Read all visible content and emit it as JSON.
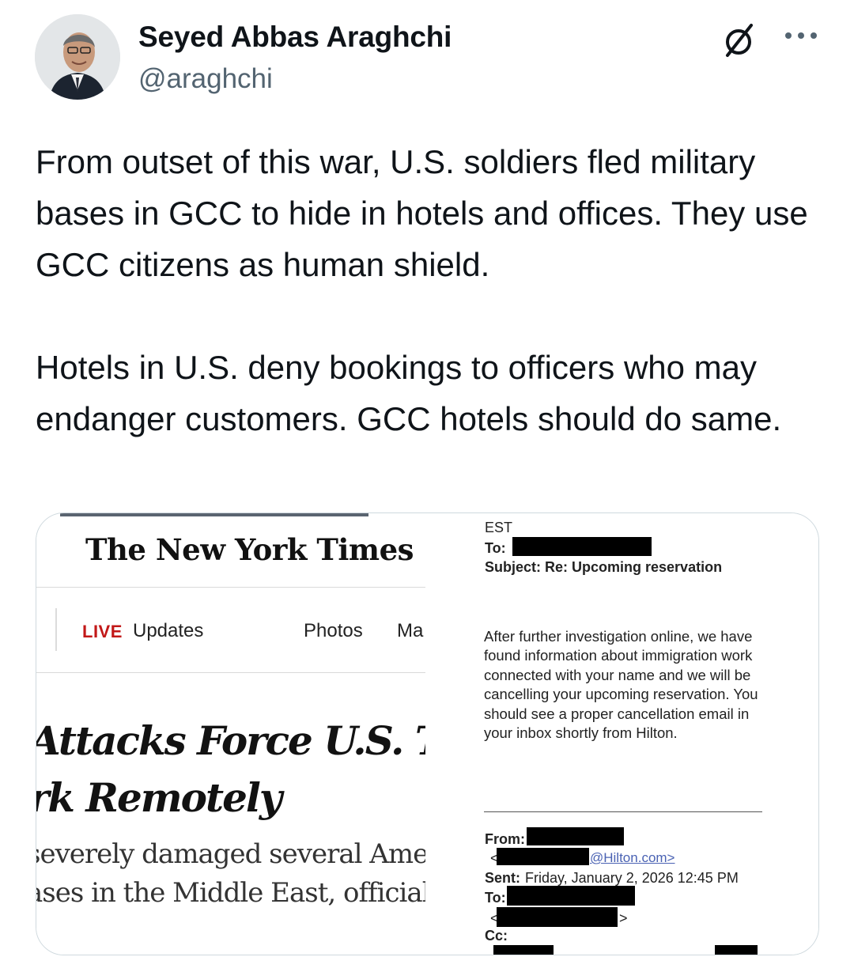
{
  "author": {
    "name": "Seyed Abbas Araghchi",
    "handle": "@araghchi"
  },
  "tweet": {
    "paragraph1": "From outset of this war, U.S. soldiers fled military bases in GCC to hide in hotels and offices. They use GCC citizens as human shield.",
    "paragraph2": "Hotels in U.S. deny bookings to officers who may endanger customers. GCC hotels should do same."
  },
  "icons": {
    "grok": "grok-icon",
    "more": "more-options-icon"
  },
  "nyt": {
    "logo": "The New York Times",
    "live": "LIVE",
    "updates": "Updates",
    "photos": "Photos",
    "ma": "Ma",
    "headline_line1": "Attacks Force U.S. Tr",
    "headline_line2": "rk Remotely",
    "sub_line1": "severely damaged several Ameri",
    "sub_line2": "ases in the Middle East, official"
  },
  "email": {
    "est": "EST",
    "to_label": "To:",
    "subject": "Subject: Re: Upcoming reservation",
    "body": "After further investigation online, we have found information about immigration work connected with your name and we will be cancelling your upcoming reservation. You should see a proper cancellation email in your inbox shortly from Hilton.",
    "from_label": "From:",
    "lt": "<",
    "hilton_address": "@Hilton.com>",
    "sent_label": "Sent:",
    "sent_value": "Friday, January 2, 2026 12:45 PM",
    "to2_label": "To:",
    "lt2": "<",
    "gt2": ">",
    "cc_label": "Cc:"
  }
}
